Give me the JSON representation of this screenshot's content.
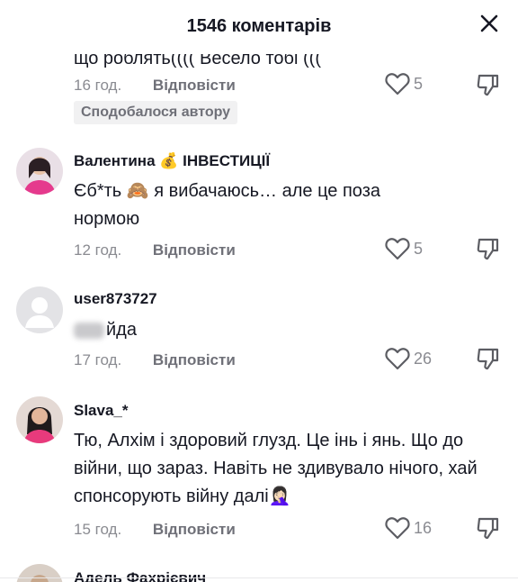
{
  "header": {
    "title": "1546 коментарів",
    "close_icon": "close-icon"
  },
  "comments": [
    {
      "text": "що роблять(((( Весело тобі (((",
      "time": "16 год.",
      "reply_label": "Відповісти",
      "likes": "5",
      "badge": "Сподобалося автору"
    },
    {
      "username": "Валентина 💰 ІНВЕСТИЦІЇ",
      "text": "Єб*ть 🙈 я вибачаюсь… але це поза нормою",
      "time": "12 год.",
      "reply_label": "Відповісти",
      "likes": "5"
    },
    {
      "username": "user873727",
      "text": "йда",
      "time": "17 год.",
      "reply_label": "Відповісти",
      "likes": "26"
    },
    {
      "username": "Slava_*",
      "text": "Тю, Алхім і здоровий глузд. Це інь і янь. Що до війни, що зараз. Навіть не здивувало нічого, хай спонсорують війну далі🤦🏻‍♀️",
      "time": "15 год.",
      "reply_label": "Відповісти",
      "likes": "16"
    },
    {
      "username": "Адель Фахрієвич"
    }
  ],
  "colors": {
    "text": "#161823",
    "secondary": "#8a8b91",
    "badge_bg": "#f1f1f2"
  }
}
